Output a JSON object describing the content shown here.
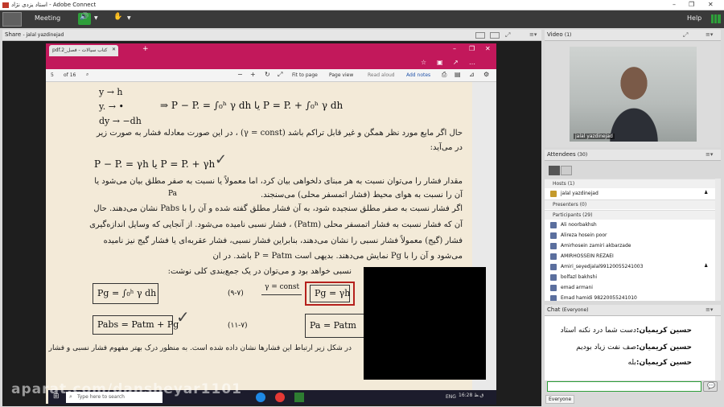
{
  "window": {
    "title": "استاد یزدی نژاد - Adobe Connect"
  },
  "menubar": {
    "meeting": "Meeting",
    "help": "Help"
  },
  "share": {
    "label": "Share",
    "presenter": "- jalal yazdinejad"
  },
  "browser": {
    "tab_title": "pdf.2_کتاب سیالات - فصل",
    "page_current": "5",
    "page_total": "of 16",
    "fit_page": "Fit to page",
    "page_view": "Page view",
    "read_aloud": "Read aloud",
    "add_notes": "Add notes"
  },
  "pdf_text": {
    "l1": "حال اگر مایع مورد نظر همگن و غیر قابل تراکم باشد (γ = const) ، در این صورت معادله فشار به صورت زیر",
    "l2": "در می‌آید:",
    "l3": "مقدار فشار را می‌توان نسبت به هر مبنای دلخواهی بیان کرد، اما معمولاً یا نسبت به صفر مطلق بیان می‌شود یا",
    "l4": "آن را نسبت به هوای محیط (فشار اتمسفر محلی) می‌سنجند.",
    "l5": "اگر فشار نسبت به صفر مطلق سنجیده شود، به آن فشار مطلق گفته شده و آن را با Pabs نشان می‌دهند. حال",
    "l6": "آن که فشار نسبت به فشار اتمسفر محلی (Patm) ، فشار نسبی نامیده می‌شود. از آنجایی که وسایل اندازه‌گیری",
    "l7": "فشار (گیج) معمولاً فشار نسبی را نشان می‌دهند، بنابراین فشار نسبی، فشار عقربه‌ای یا فشار گیج نیز نامیده",
    "l8": "می‌شود و آن را با Pg نمایش می‌دهند. بدیهی است P = Patm باشد. در ان",
    "l9": "نسبی خواهد بود و می‌توان در یک جمع‌بندی کلی نوشت:",
    "l10": "در شکل زیر ارتباط این فشارها نشان داده شده است. به منظور درک بهتر مفهوم فشار نسبی و فشار مطلق ارائه می‌دهند."
  },
  "equations": {
    "e1": "y → h",
    "e2": "y. → •",
    "e3": "dy → −dh",
    "e4": "⇒  P − P. = ∫₀ʰ γ dh   یا   P = P. + ∫₀ʰ γ dh",
    "e5": "P − P. = γh   یا   P = P. + γh",
    "e6": "Pg = ∫₀ʰ γ dh",
    "e7": "(۹-۷)",
    "e8": "γ = const",
    "e9": "Pg = γh",
    "e10": "Pabs = Patm + Pg",
    "e11": "(۱۱-۷)",
    "e12": "Pa = Patm",
    "e13": "Pa"
  },
  "taskbar": {
    "search": "Type here to search",
    "lang": "ENG",
    "clock": "16:28 ق.ظ"
  },
  "watermark": "aparat.com/dansheyar1101",
  "video": {
    "label": "Video",
    "count": "(1)",
    "name": "jalal yazdinejad"
  },
  "attendees": {
    "label": "Attendees",
    "count": "(30)",
    "hosts_group": "Hosts (1)",
    "host": "jalal yazdinejad",
    "presenters_group": "Presenters (0)",
    "participants_group": "Participants (29)",
    "participants": [
      "Ali noorbakhsh",
      "Alireza hosein poor",
      "Amirhosein zamiri akbarzade",
      "AMIRHOSSEIN REZAEI",
      "Amiri_seyedjalal99120055241003",
      "bolfazl bakhshi",
      "emad armani",
      "Emad hamidi 98220055241010"
    ]
  },
  "chat": {
    "label": "Chat",
    "scope": "(Everyone)",
    "messages": [
      {
        "sender": "حسین کریمیان:",
        "text": "دست شما درد نکنه استاد"
      },
      {
        "sender": "حسین کریمیان:",
        "text": "صف نفت زیاد بودیم"
      },
      {
        "sender": "حسین کریمیان:",
        "text": "بله"
      }
    ],
    "target": "Everyone"
  },
  "colors": {
    "accent": "#c2185b",
    "dark": "#3a3a3a",
    "ink": "#b5201c",
    "input_border": "#2e9e3a"
  }
}
